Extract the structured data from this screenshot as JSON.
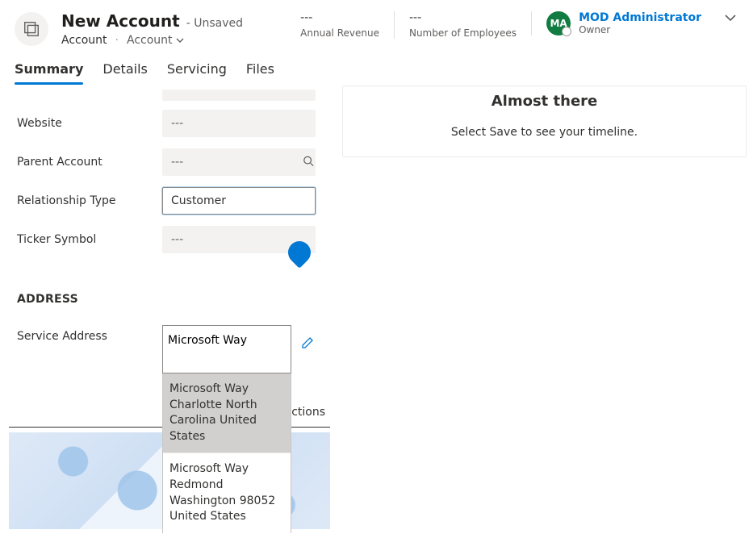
{
  "header": {
    "title": "New Account",
    "unsaved_label": "- Unsaved",
    "entity_label": "Account",
    "form_selector": "Account",
    "stats": {
      "revenue_value": "---",
      "revenue_label": "Annual Revenue",
      "employees_value": "---",
      "employees_label": "Number of Employees"
    },
    "owner": {
      "initials": "MA",
      "name": "MOD Administrator",
      "label": "Owner"
    }
  },
  "tabs": {
    "summary": "Summary",
    "details": "Details",
    "servicing": "Servicing",
    "files": "Files"
  },
  "form": {
    "website_label": "Website",
    "website_value": "---",
    "parent_label": "Parent Account",
    "parent_value": "---",
    "relationship_label": "Relationship Type",
    "relationship_value": "Customer",
    "ticker_label": "Ticker Symbol",
    "ticker_value": "---"
  },
  "address": {
    "section": "ADDRESS",
    "label": "Service Address",
    "input_value": "Microsoft Way",
    "suggestions": [
      "Microsoft Way Charlotte North Carolina United States",
      "Microsoft Way Redmond Washington 98052 United States"
    ]
  },
  "map": {
    "actions_label": "ctions"
  },
  "timeline": {
    "title": "Almost there",
    "message": "Select Save to see your timeline."
  }
}
